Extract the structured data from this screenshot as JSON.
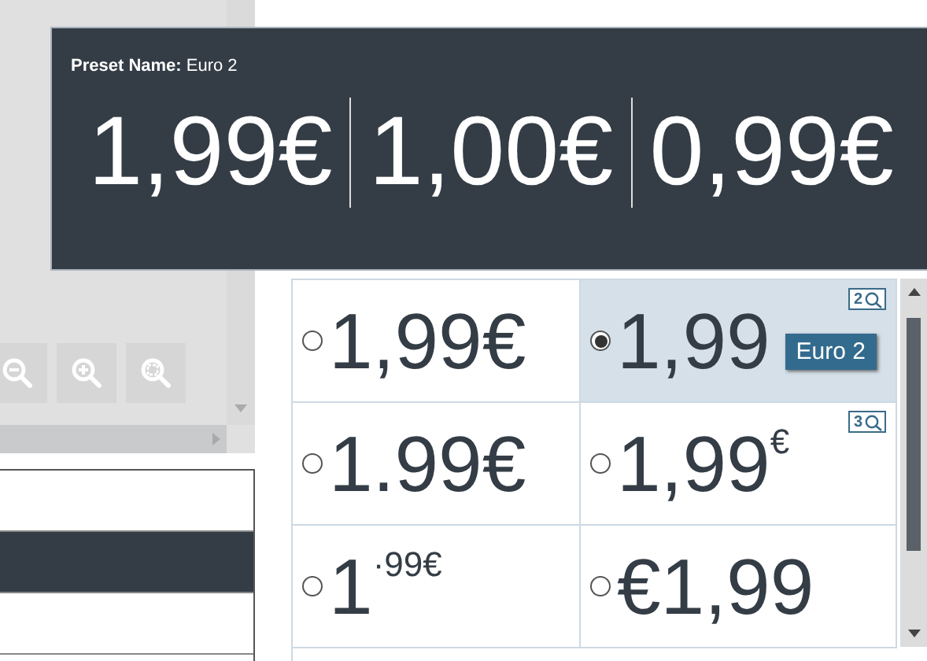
{
  "preset_popup": {
    "label": "Preset Name:",
    "name": "Euro 2",
    "prices": [
      "1,99€",
      "1,00€",
      "0,99€"
    ]
  },
  "zoom_buttons": [
    {
      "kind": "zoom-out"
    },
    {
      "kind": "zoom-in"
    },
    {
      "kind": "zoom-fit"
    }
  ],
  "list": {
    "rows": [
      {
        "selected": false
      },
      {
        "selected": true
      },
      {
        "selected": false
      }
    ]
  },
  "preset_rows": [
    {
      "cells": [
        {
          "price": "1,99€",
          "selected": false
        },
        {
          "price": "1,99",
          "selected": true,
          "badge": "2"
        }
      ]
    },
    {
      "cells": [
        {
          "price": "1.99€",
          "selected": false
        },
        {
          "price": "1,99$^{€}$",
          "selected": false,
          "badge": "3"
        }
      ]
    },
    {
      "cells": [
        {
          "price": "1$^{·99€}$",
          "selected": false
        },
        {
          "price": "€1,99",
          "selected": false
        }
      ]
    }
  ],
  "tooltip": {
    "text": "Euro 2"
  }
}
